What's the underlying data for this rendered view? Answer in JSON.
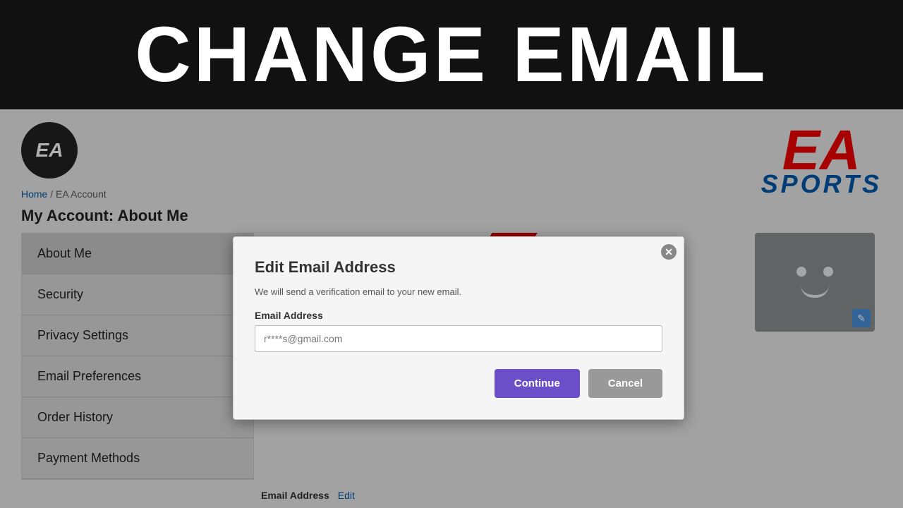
{
  "banner": {
    "title": "CHANGE EMAIL"
  },
  "header": {
    "ea_logo": "EA",
    "ea_sports_ea": "EA",
    "ea_sports_sports": "SPORTS"
  },
  "breadcrumb": {
    "home": "Home",
    "separator": " / ",
    "current": "EA Account"
  },
  "page_title": "My Account: About Me",
  "sidebar": {
    "items": [
      {
        "label": "About Me"
      },
      {
        "label": "Security"
      },
      {
        "label": "Privacy Settings"
      },
      {
        "label": "Email Preferences"
      },
      {
        "label": "Order History"
      },
      {
        "label": "Payment Methods"
      }
    ]
  },
  "modal": {
    "close_symbol": "✕",
    "title": "Edit Email Address",
    "subtitle": "We will send a verification email to your new email.",
    "email_label": "Email Address",
    "email_placeholder": "r****s@gmail.com",
    "continue_label": "Continue",
    "cancel_label": "Cancel"
  },
  "email_row": {
    "label": "Email Address",
    "edit_link": "Edit"
  }
}
